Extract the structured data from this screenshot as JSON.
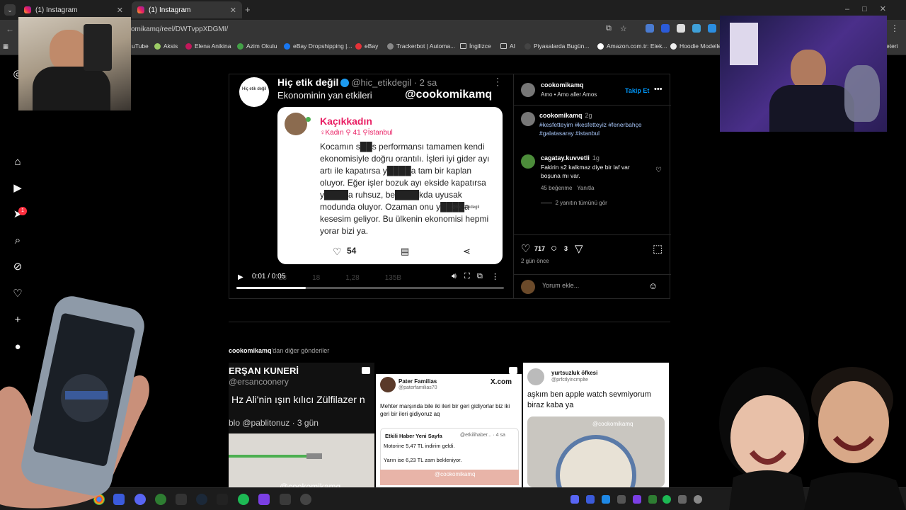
{
  "browser": {
    "tabs": [
      {
        "title": "(1) Instagram",
        "active": false
      },
      {
        "title": "(1) Instagram",
        "active": true
      }
    ],
    "url": "komikamq/reel/DWTvppXDGMI/",
    "bookmarks": [
      "uTube",
      "Aksis",
      "Elena Anikina",
      "Azim Okulu",
      "eBay Dropshipping |...",
      "eBay",
      "Trackerbot | Automa...",
      "İngilizce",
      "AI",
      "Piyasalarda Bugün...",
      "Amazon.com.tr: Elek...",
      "Hoodie Modelle",
      "eteri"
    ]
  },
  "nav": {
    "notification_count": "1"
  },
  "video": {
    "tweet_name": "Hiç etik değil",
    "tweet_handle": "@hic_etikdegil · 2 sa",
    "tweet_text": "Ekonominin yan etkileri",
    "avatar_text": "Hiç etik değil",
    "watermark": "@cookomikamq",
    "card": {
      "name": "Kaçıkkadın",
      "meta": "♀Kadın  ⚲ 41  ⚲İstanbul",
      "body": "Kocamın s██s performansı tamamen kendi ekonomisiyle doğru orantılı. İşleri iyi gider ayı artı ile kapatırsa y████a tam bir kaplan oluyor. Eğer işler bozuk ayı ekside kapatırsa y████a ruhsuz, be████kda uyusak modunda oluyor. Ozaman onu y████a kesesim geliyor. Bu ülkenin ekonomisi hepmi yorar bizi ya.",
      "likes": "54",
      "small_watermark": "@hic_etikdegil"
    },
    "ghost_counts": [
      "28",
      "18",
      "1,28",
      "135B"
    ],
    "time": "0:01 / 0:05",
    "progress": 0.26
  },
  "post": {
    "username": "cookomikamq",
    "subline": "Amo • Amo aller Amos",
    "follow_label": "Takip Et",
    "caption_user": "cookomikamq",
    "caption_time": "2g",
    "caption_tags": "#kesfetteyim #kesfetteyiz #fenerbahçe #galatasaray #istanbul",
    "comment": {
      "user": "cagatay.kuvvetli",
      "time": "1g",
      "text": "Fakirin s2 kalkmaz diye bir laf var boşuna mı var.",
      "likes": "45 beğenme",
      "reply": "Yanıtla",
      "view_replies": "2 yanıtın tümünü gör"
    },
    "like_count": "717",
    "comment_count": "3",
    "date": "2 gün önce",
    "comment_placeholder": "Yorum ekle..."
  },
  "more": {
    "user": "cookomikamq",
    "suffix": "'dan diğer gönderiler",
    "thumbs": [
      {
        "name": "ERŞAN KUNERİ",
        "handle": "@ersancoonery",
        "text": "Hz Ali'nin ışın kılıcı Zülfilazer n",
        "sub": "blo @pablitonuz · 3 gün",
        "watermark": "@cookomikamq"
      },
      {
        "name": "Pater Familias",
        "handle": "@paterfamilias70",
        "brand": "X.com",
        "text": "Mehter marşında bile iki ileri bir geri gidiyorlar biz iki geri bir ileri gidiyoruz aq",
        "quote_name": "Etkili Haber Yeni Sayfa",
        "quote_handle": "@etkilihaber... · 4 sa",
        "quote_l1": "Motorine 5,47 TL indirim geldi.",
        "quote_l2": "Yarın ise 6,23 TL zam bekleniyor.",
        "watermark": "@cookomikamq"
      },
      {
        "name": "yurtsuzluk öfkesi",
        "handle": "@prfctlyincmplte",
        "text": "aşkım ben apple watch sevmiyorum biraz kaba ya",
        "watermark": "@cookomikamq"
      }
    ]
  },
  "colors": {
    "instagram_blue": "#0095f6",
    "hashtag": "#a8c7fa",
    "card_pink": "#e91e63",
    "badge_red": "#ff3040"
  }
}
